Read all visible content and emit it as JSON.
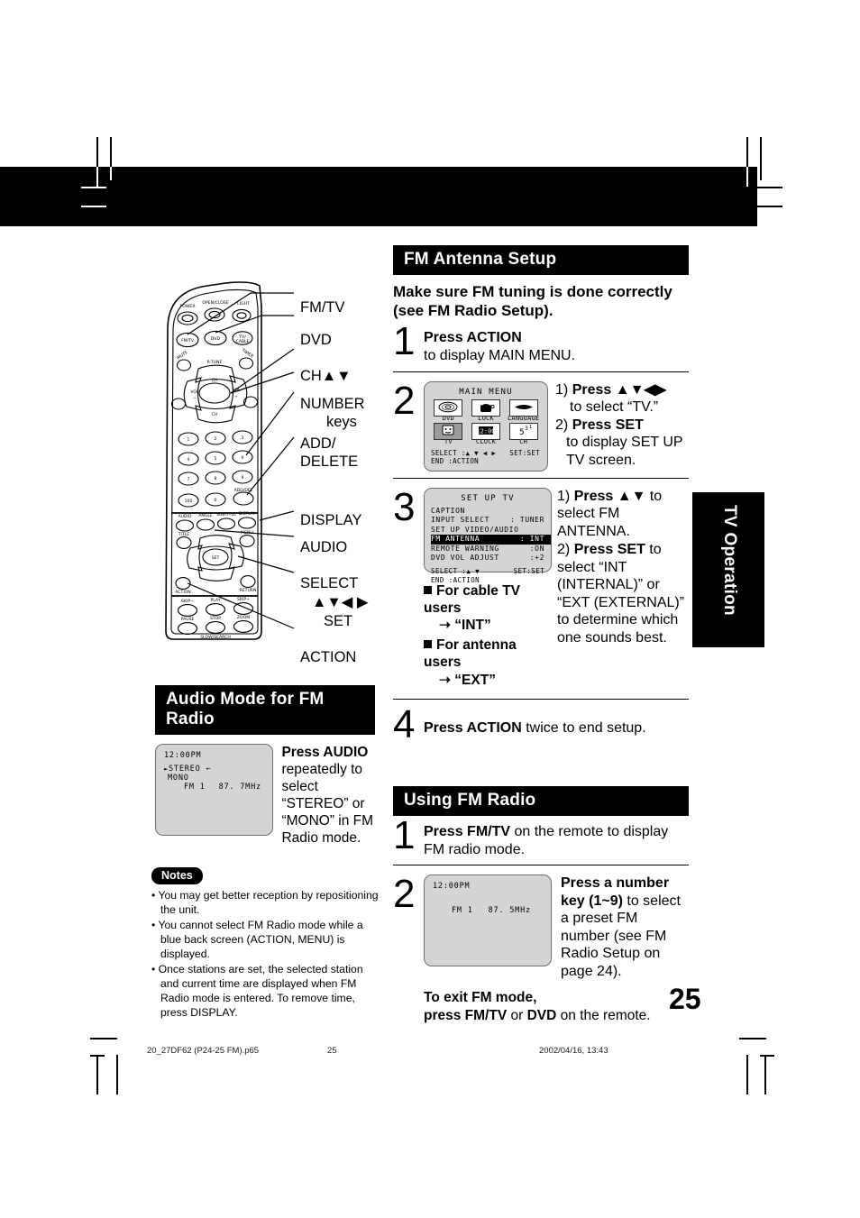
{
  "page": {
    "number": "25",
    "side_tab": "TV Operation"
  },
  "footer": {
    "file": "20_27DF62 (P24-25 FM).p65",
    "page": "25",
    "timestamp": "2002/04/16, 13:43"
  },
  "remote": {
    "callouts": [
      {
        "label": "FM/TV"
      },
      {
        "label": "DVD"
      },
      {
        "label": "CH▲▼"
      },
      {
        "label": "NUMBER"
      },
      {
        "label": "keys"
      },
      {
        "label": "ADD/"
      },
      {
        "label": "DELETE"
      },
      {
        "label": "DISPLAY"
      },
      {
        "label": "AUDIO"
      },
      {
        "label": "SELECT"
      },
      {
        "label": "▲▼◀ ▶"
      },
      {
        "label": "SET"
      },
      {
        "label": "ACTION"
      }
    ],
    "button_labels": {
      "power": "POWER",
      "open_close": "OPEN/CLOSE",
      "light": "LIGHT",
      "fmtv": "FM/TV",
      "dvd": "DVD",
      "tvcable": "TV/CABLE",
      "mute": "MUTE",
      "r_tune": "R-TUNE",
      "timer": "TIMER",
      "recall": "RECALL",
      "vol_minus": "VOL −",
      "vol_plus": "VOL +",
      "ch_up": "CH ▲",
      "ch_down": "CH ▼",
      "add_del": "ADD/DEL",
      "hundred": "100",
      "zero": "0",
      "audio": "AUDIO",
      "angle": "ANGLE",
      "subtitle": "SUBTITLE",
      "display": "DISPLAY",
      "title": "TITLE",
      "menu": "MENU",
      "set": "SET",
      "action": "ACTION",
      "return": "RETURN",
      "skip_minus": "SKIP −",
      "play": "PLAY",
      "skip_plus": "SKIP +",
      "pause": "PAUSE",
      "stop": "STOP",
      "zoom": "ZOOM",
      "slow_search": "SLOW/SEARCH",
      "numbers": [
        "1",
        "2",
        "3",
        "4",
        "5",
        "6",
        "7",
        "8",
        "9"
      ]
    }
  },
  "fm_antenna_setup": {
    "title": "FM Antenna Setup",
    "lead": "Make sure FM tuning is done correctly (see FM Radio Setup).",
    "steps": [
      {
        "num": "1",
        "bold": "Press ACTION",
        "text": "to display MAIN MENU."
      },
      {
        "num": "2",
        "instructions": [
          {
            "n": "1)",
            "bold": "Press ▲▼◀▶",
            "text": "to select “TV.”"
          },
          {
            "n": "2)",
            "bold": "Press SET",
            "text": "to display SET UP TV screen."
          }
        ],
        "osd": {
          "title": "MAIN MENU",
          "items": [
            {
              "label": "DVD",
              "icon": "disc-icon",
              "selected": false
            },
            {
              "label": "LOCK",
              "icon": "lock-icon",
              "selected": false
            },
            {
              "label": "LANGUAGE",
              "icon": "language-icon",
              "selected": false
            },
            {
              "label": "TV",
              "icon": "tv-icon",
              "selected": true
            },
            {
              "label": "CLOCK",
              "icon": "clock-icon",
              "selected": false
            },
            {
              "label": "CH",
              "icon": "channel-icon",
              "selected": false
            }
          ],
          "footer_select": "SELECT :▲ ▼ ◀ ▶",
          "footer_set": "SET:SET",
          "footer_end": "END    :ACTION"
        }
      },
      {
        "num": "3",
        "instructions": [
          {
            "n": "1)",
            "bold": "Press ▲▼",
            "text": "to select FM ANTENNA."
          },
          {
            "n": "2)",
            "bold": "Press SET",
            "text": "to select “INT (INTERNAL)” or “EXT (EXTERNAL)” to determine which one sounds best."
          }
        ],
        "osd": {
          "title": "SET UP TV",
          "rows": [
            {
              "name": "CAPTION",
              "value": "",
              "highlight": false
            },
            {
              "name": "INPUT SELECT",
              "value": ": TUNER",
              "highlight": false
            },
            {
              "name": "SET UP VIDEO/AUDIO",
              "value": "",
              "highlight": false
            },
            {
              "name": "FM ANTENNA",
              "value": ": INT",
              "highlight": true
            },
            {
              "name": "REMOTE WARNING",
              "value": ":ON",
              "highlight": false
            },
            {
              "name": "DVD VOL ADJUST",
              "value": ":+2",
              "highlight": false
            }
          ],
          "footer_select": "SELECT :▲ ▼",
          "footer_set": "SET:SET",
          "footer_end": "END    :ACTION"
        },
        "bullets": [
          {
            "head": "For cable TV users",
            "sub": "➝ “INT”"
          },
          {
            "head": "For antenna users",
            "sub": "➝ “EXT”"
          }
        ]
      },
      {
        "num": "4",
        "bold": "Press ACTION",
        "text": "twice to end setup."
      }
    ]
  },
  "audio_mode": {
    "title": "Audio Mode for  FM Radio",
    "bold": "Press AUDIO",
    "text": "repeatedly to select “STEREO” or “MONO” in FM Radio mode.",
    "osd": {
      "time": "12:00PM",
      "stereo": "STEREO",
      "mono": "MONO",
      "station": "FM 1",
      "frequency": "87. 7MHz"
    }
  },
  "notes": {
    "label": "Notes",
    "items": [
      "You may get better reception by repositioning the unit.",
      "You cannot select FM Radio mode while a blue back screen (ACTION, MENU) is displayed.",
      "Once stations are set, the selected station and current time are displayed when FM Radio mode is entered. To remove time, press DISPLAY."
    ]
  },
  "using_fm_radio": {
    "title": "Using FM Radio",
    "steps": [
      {
        "num": "1",
        "bold": "Press FM/TV",
        "text": "on the remote to display FM radio mode."
      },
      {
        "num": "2",
        "bold": "Press a number key (1~9)",
        "text": "to select a preset FM number (see FM Radio Setup on page 24).",
        "osd": {
          "time": "12:00PM",
          "station": "FM 1",
          "frequency": "87. 5MHz"
        }
      }
    ],
    "exit_line1": "To exit FM mode,",
    "exit_line2_a": "press FM/TV",
    "exit_line2_b": "or",
    "exit_line2_c": "DVD",
    "exit_line2_d": "on the remote."
  }
}
